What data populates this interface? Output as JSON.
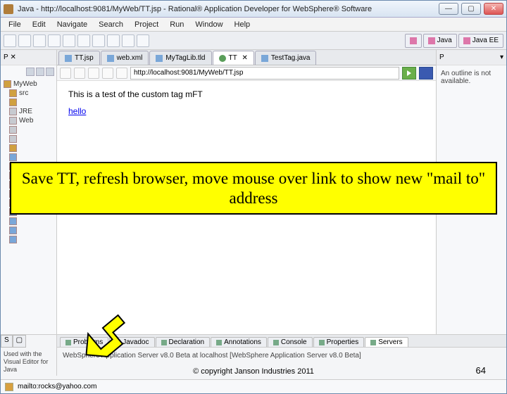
{
  "window": {
    "title": "Java - http://localhost:9081/MyWeb/TT.jsp - Rational® Application Developer for WebSphere® Software"
  },
  "menu": [
    "File",
    "Edit",
    "Navigate",
    "Search",
    "Project",
    "Run",
    "Window",
    "Help"
  ],
  "perspectives": {
    "java": "Java",
    "javaee": "Java EE"
  },
  "left_panel": {
    "tab": "P",
    "project": "MyWeb",
    "nodes": [
      "src",
      "JRE",
      "Web",
      "",
      "",
      "",
      "",
      "",
      "",
      "",
      ""
    ]
  },
  "editor": {
    "tabs": [
      {
        "label": "TT.jsp"
      },
      {
        "label": "web.xml"
      },
      {
        "label": "MyTagLib.tld"
      },
      {
        "label": "TT",
        "active": true
      },
      {
        "label": "TestTag.java"
      }
    ],
    "url": "http://localhost:9081/MyWeb/TT.jsp",
    "page_text": "This is a test of the custom tag mFT",
    "link_text": "hello"
  },
  "right_panel": {
    "tab": "P",
    "text": "An outline is not available."
  },
  "bottom": {
    "left_desc": "Used with the Visual Editor for Java",
    "tabs": [
      "Problems",
      "Javadoc",
      "Declaration",
      "Annotations",
      "Console",
      "Properties",
      "Servers"
    ],
    "active_tab": "Servers",
    "server_line": "WebSphere Application Server v8.0 Beta at localhost [WebSphere Application Server v8.0 Beta]"
  },
  "status": {
    "text": "mailto:rocks@yahoo.com"
  },
  "callout": "Save TT, refresh browser, move mouse over link to show new \"mail to\" address",
  "footer": {
    "copyright": "© copyright Janson Industries 2011",
    "slide": "64"
  }
}
